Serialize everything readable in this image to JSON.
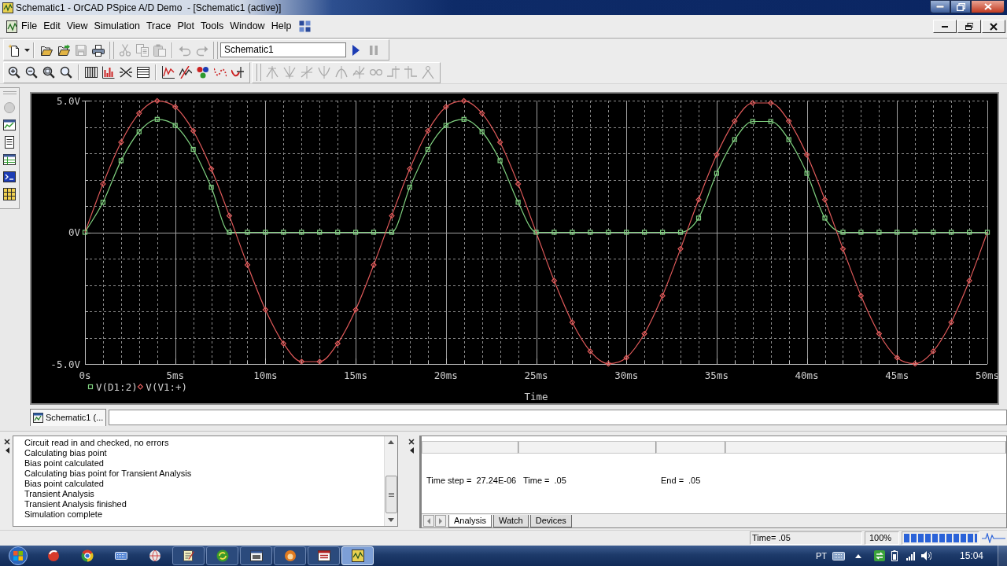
{
  "window": {
    "title": "Schematic1 - OrCAD PSpice A/D Demo  - [Schematic1 (active)]"
  },
  "menu_bar": {
    "items": [
      "File",
      "Edit",
      "View",
      "Simulation",
      "Trace",
      "Plot",
      "Tools",
      "Window",
      "Help"
    ]
  },
  "toolbar_1": {
    "buttons": [
      {
        "disabled": false
      },
      {
        "disabled": false
      },
      {
        "disabled": false
      },
      {
        "disabled": true
      },
      {
        "disabled": false
      },
      {
        "disabled": true
      },
      {
        "disabled": true
      },
      {
        "disabled": true
      },
      {
        "disabled": true
      },
      {
        "disabled": true
      }
    ],
    "profile_field": {
      "value": "Schematic1"
    },
    "run_buttons": [
      {
        "disabled": false
      },
      {
        "disabled": true
      }
    ]
  },
  "toolbar_2": {
    "buttons": [
      {
        "disabled": false
      },
      {
        "disabled": false
      },
      {
        "disabled": false
      },
      {
        "disabled": false
      },
      {
        "disabled": false
      },
      {
        "disabled": false
      },
      {
        "disabled": false
      },
      {
        "disabled": false
      },
      {
        "disabled": false
      },
      {
        "disabled": false
      },
      {
        "disabled": false
      },
      {
        "disabled": false
      },
      {
        "disabled": false
      },
      {
        "disabled": true
      },
      {
        "disabled": true
      },
      {
        "disabled": true
      },
      {
        "disabled": true
      },
      {
        "disabled": true
      },
      {
        "disabled": true
      },
      {
        "disabled": true
      },
      {
        "disabled": true
      },
      {
        "disabled": true
      },
      {
        "disabled": true
      }
    ]
  },
  "side_toolbar": {
    "buttons": [
      {
        "disabled": true
      },
      {
        "disabled": false
      },
      {
        "disabled": false
      },
      {
        "disabled": false
      },
      {
        "disabled": false
      },
      {
        "disabled": false
      }
    ]
  },
  "plot_window": {
    "chart_data": [
      {
        "type": "line",
        "xlabel": "Time",
        "x": [
          0,
          1,
          2,
          3,
          4,
          5,
          6,
          7,
          8,
          9,
          10,
          11,
          12,
          13,
          14,
          15,
          16,
          17,
          18,
          19,
          20,
          21,
          22,
          23,
          24,
          25,
          26,
          27,
          28,
          29,
          30,
          31,
          32,
          33,
          34,
          35,
          36,
          37,
          38,
          39,
          40,
          41,
          42,
          43,
          44,
          45,
          46,
          47,
          48,
          49,
          50
        ],
        "xlim": [
          0,
          50
        ],
        "ylim": [
          -5,
          5
        ],
        "xticks": [
          {
            "value": 0,
            "label": "0s"
          },
          {
            "value": 5,
            "label": "5ms"
          },
          {
            "value": 10,
            "label": "10ms"
          },
          {
            "value": 15,
            "label": "15ms"
          },
          {
            "value": 20,
            "label": "20ms"
          },
          {
            "value": 25,
            "label": "25ms"
          },
          {
            "value": 30,
            "label": "30ms"
          },
          {
            "value": 35,
            "label": "35ms"
          },
          {
            "value": 40,
            "label": "40ms"
          },
          {
            "value": 45,
            "label": "45ms"
          },
          {
            "value": 50,
            "label": "50ms"
          }
        ],
        "yticks": [
          {
            "value": 5,
            "label": "5.0V"
          },
          {
            "value": 0,
            "label": "0V"
          },
          {
            "value": -5,
            "label": "-5.0V"
          }
        ],
        "grid": true,
        "legend": "bottom",
        "series": [
          {
            "name": "V(D1:2)",
            "color": "#7fd07f",
            "marker": "square",
            "values": [
              0,
              1.14,
              2.72,
              3.82,
              4.29,
              4.06,
              3.15,
              1.71,
              0,
              0,
              0,
              0,
              0,
              0,
              0,
              0,
              0,
              0,
              1.71,
              3.15,
              4.06,
              4.29,
              3.82,
              2.72,
              1.14,
              0,
              0,
              0,
              0,
              0,
              0,
              0,
              0,
              0,
              0.54,
              2.24,
              3.52,
              4.21,
              4.21,
              3.52,
              2.24,
              0.54,
              0,
              0,
              0,
              0,
              0,
              0,
              0,
              0,
              0
            ]
          },
          {
            "name": "V(V1:+)",
            "color": "#e05a5a",
            "marker": "diamond",
            "values": [
              0,
              1.84,
              3.42,
              4.52,
              4.99,
              4.76,
              3.85,
              2.41,
              0.63,
              -1.24,
              -2.94,
              -4.22,
              -4.91,
              -4.91,
              -4.22,
              -2.94,
              -1.24,
              0.63,
              2.41,
              3.85,
              4.76,
              4.99,
              4.52,
              3.42,
              1.84,
              0,
              -1.84,
              -3.42,
              -4.52,
              -4.99,
              -4.76,
              -3.85,
              -2.41,
              -0.63,
              1.24,
              2.94,
              4.22,
              4.91,
              4.91,
              4.22,
              2.94,
              1.24,
              -0.63,
              -2.41,
              -3.85,
              -4.76,
              -4.99,
              -4.52,
              -3.42,
              -1.84,
              0
            ]
          }
        ]
      }
    ]
  },
  "document_tabs": [
    {
      "label": "Schematic1 (...",
      "selected": true
    }
  ],
  "output_log": {
    "lines": [
      "Circuit read in and checked, no errors",
      "Calculating bias point",
      "Bias point calculated",
      "Calculating bias point for Transient Analysis",
      "Bias point calculated",
      "Transient Analysis",
      "Transient Analysis finished",
      "Simulation complete"
    ]
  },
  "simulation_status": {
    "fields": [
      {
        "label": "Time step =",
        "value": "27.24E-06"
      },
      {
        "label": "Time =",
        "value": ".05"
      },
      {
        "label": "End =",
        "value": ".05"
      }
    ],
    "tabs": [
      {
        "label": "Analysis",
        "selected": true
      },
      {
        "label": "Watch",
        "selected": false
      },
      {
        "label": "Devices",
        "selected": false
      }
    ]
  },
  "status_bar": {
    "time": "Time= .05",
    "zoom": "100%",
    "progress": {
      "level": 1
    }
  },
  "taskbar": {
    "apps": [
      {
        "running": false,
        "selected": false
      },
      {
        "running": false,
        "selected": false
      },
      {
        "running": false,
        "selected": false
      },
      {
        "running": false,
        "selected": false
      },
      {
        "running": true,
        "selected": false
      },
      {
        "running": true,
        "selected": false
      },
      {
        "running": true,
        "selected": false
      },
      {
        "running": true,
        "selected": false
      },
      {
        "running": true,
        "selected": false
      },
      {
        "running": true,
        "selected": true
      }
    ],
    "language": "PT",
    "clock": "15:04"
  }
}
